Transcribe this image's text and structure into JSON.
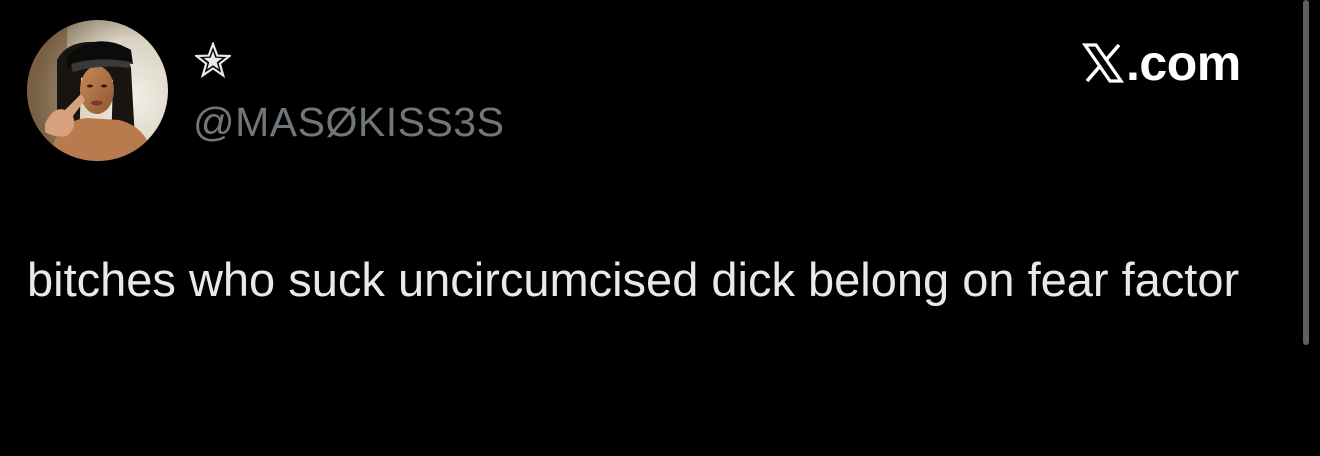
{
  "tweet": {
    "display_name": "✩",
    "handle": "@MASØKISS3S",
    "text": "bitches who suck uncircumcised dick belong on fear factor",
    "avatar_icon": "user-avatar-photo"
  },
  "branding": {
    "logo_text": ".com",
    "logo_icon": "x-logo-icon"
  },
  "colors": {
    "background": "#000000",
    "text_primary": "#e7e9ea",
    "text_secondary": "#71767b",
    "logo": "#ffffff"
  }
}
